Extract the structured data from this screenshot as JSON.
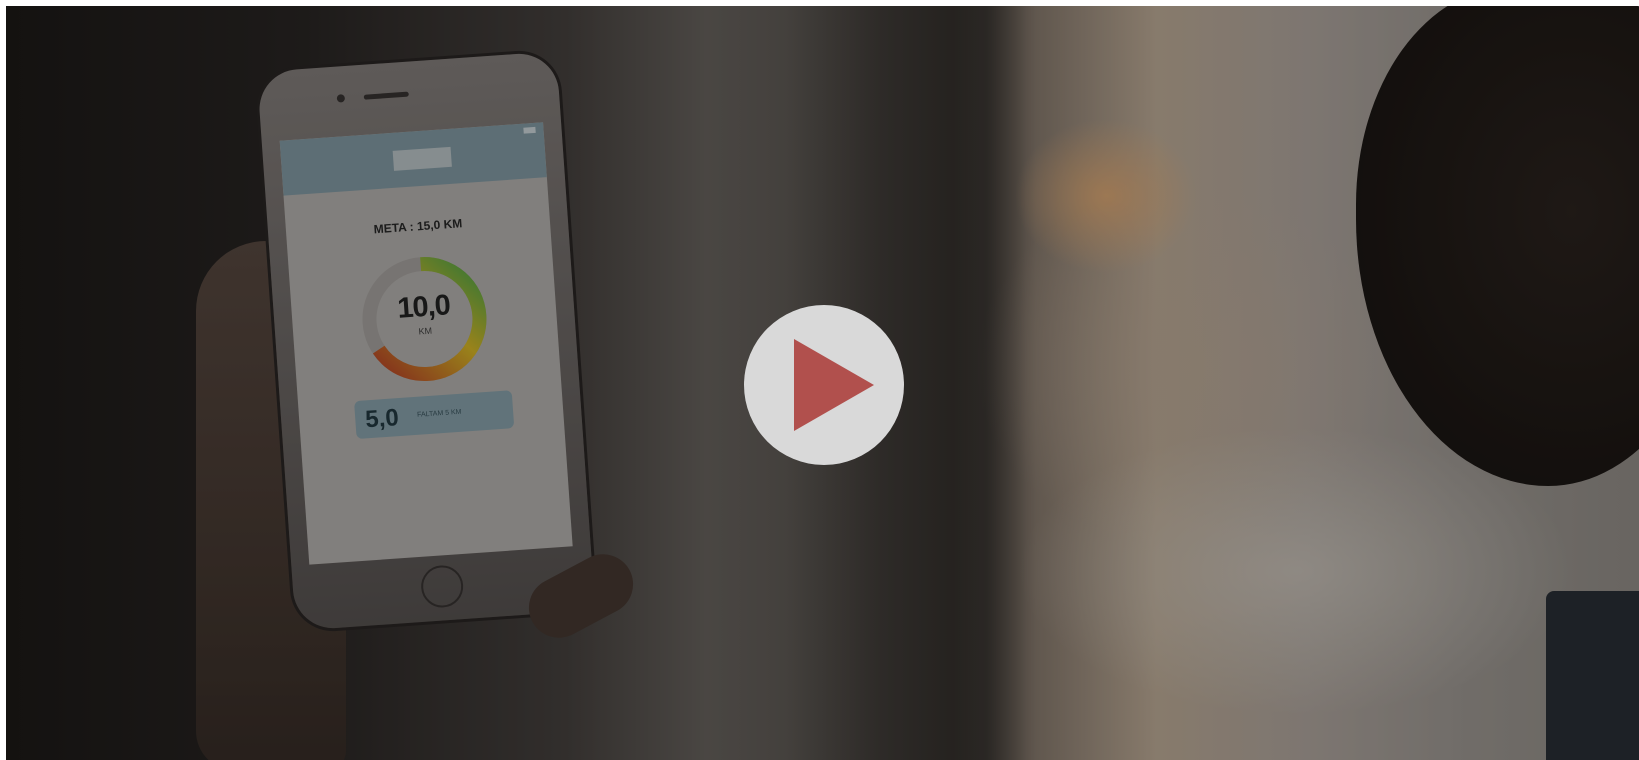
{
  "video": {
    "app_screen": {
      "tabs": [
        "",
        ""
      ],
      "goal_text": "META : 15,0 KM",
      "progress_value": "10,0",
      "progress_unit": "KM",
      "progress_fraction": 0.6667,
      "remaining_value": "5,0",
      "remaining_label": "FALTAM 5 KM"
    },
    "play_button": {
      "icon": "play-icon"
    },
    "colors": {
      "play_icon": "#b1504d",
      "play_circle": "#d9d9d9",
      "ring_start": "#c0392b",
      "ring_mid": "#e3c128",
      "ring_end": "#4caf50"
    }
  }
}
